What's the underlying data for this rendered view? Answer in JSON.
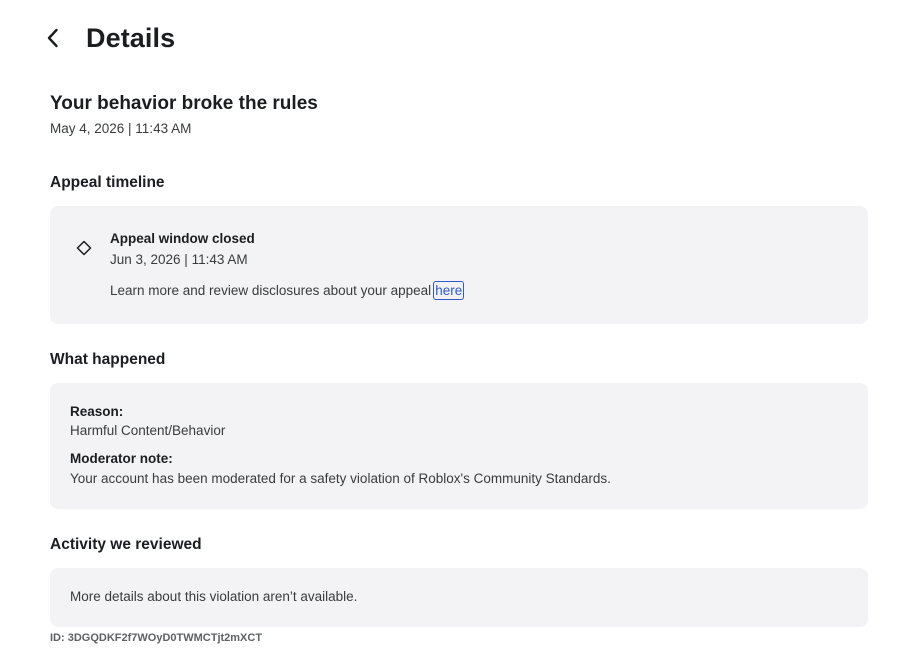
{
  "header": {
    "title": "Details",
    "back_icon": "chevron-left-icon"
  },
  "violation": {
    "title": "Your behavior broke the rules",
    "date": "May 4, 2026 | 11:43 AM"
  },
  "appeal_timeline": {
    "heading": "Appeal timeline",
    "icon": "diamond-icon",
    "status_title": "Appeal window closed",
    "status_date": "Jun 3, 2026 | 11:43 AM",
    "learn_more_text": "Learn more and review disclosures about your appeal",
    "link_label": "here"
  },
  "what_happened": {
    "heading": "What happened",
    "reason_label": "Reason:",
    "reason_value": "Harmful Content/Behavior",
    "note_label": "Moderator note:",
    "note_value": "Your account has been moderated for a safety violation of Roblox's Community Standards."
  },
  "activity": {
    "heading": "Activity we reviewed",
    "message": "More details about this violation aren’t available."
  },
  "footer": {
    "id_text": "ID: 3DGQDKF2f7WOyD0TWMCTjt2mXCT"
  },
  "colors": {
    "text_primary": "#1b1d21",
    "text_secondary": "#393b3d",
    "card_background": "#f3f3f5",
    "link": "#2f58cd"
  }
}
